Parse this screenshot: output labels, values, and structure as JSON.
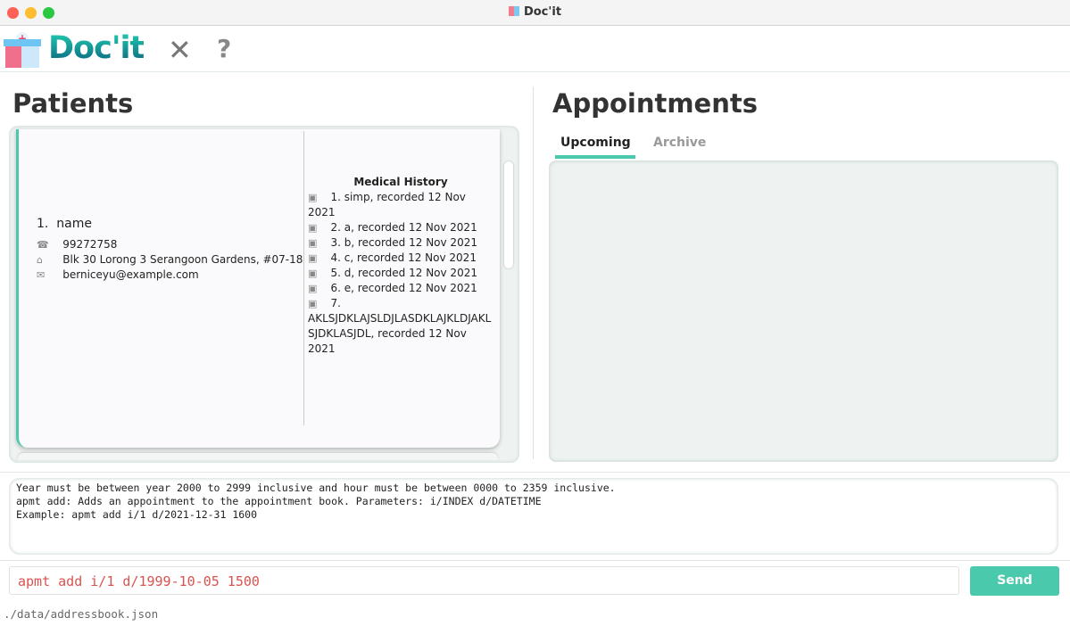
{
  "window": {
    "title": "Doc'it",
    "title_icon": "clinic-icon"
  },
  "header": {
    "logo_text": "Doc'it",
    "close_label": "✕",
    "help_label": "?"
  },
  "patients": {
    "title": "Patients",
    "items": [
      {
        "index": "1.",
        "name": "name",
        "phone": "99272758",
        "address": "Blk 30 Lorong 3 Serangoon Gardens, #07-18",
        "email": "berniceyu@example.com",
        "medical_history_title": "Medical History",
        "medical_history": [
          "1. simp, recorded 12 Nov 2021",
          "2. a, recorded 12 Nov 2021",
          "3. b, recorded 12 Nov 2021",
          "4. c, recorded 12 Nov 2021",
          "5. d, recorded 12 Nov 2021",
          "6. e, recorded 12 Nov 2021",
          "7.",
          "AKLSJDKLAJSLDJLASDKLAJKLDJAKL",
          "SJDKLASJDL, recorded 12 Nov 2021"
        ]
      }
    ]
  },
  "appointments": {
    "title": "Appointments",
    "tabs": [
      {
        "label": "Upcoming",
        "active": true
      },
      {
        "label": "Archive",
        "active": false
      }
    ]
  },
  "result": {
    "text": "Year must be between year 2000 to 2999 inclusive and hour must be between 0000 to 2359 inclusive.\napmt add: Adds an appointment to the appointment book. Parameters: i/INDEX d/DATETIME\nExample: apmt add i/1 d/2021-12-31 1600"
  },
  "command": {
    "value": "apmt add i/1 d/1999-10-05 1500",
    "send_label": "Send"
  },
  "status": {
    "path": "./data/addressbook.json"
  },
  "colors": {
    "accent": "#4bc9ad",
    "error": "#d9534f"
  }
}
